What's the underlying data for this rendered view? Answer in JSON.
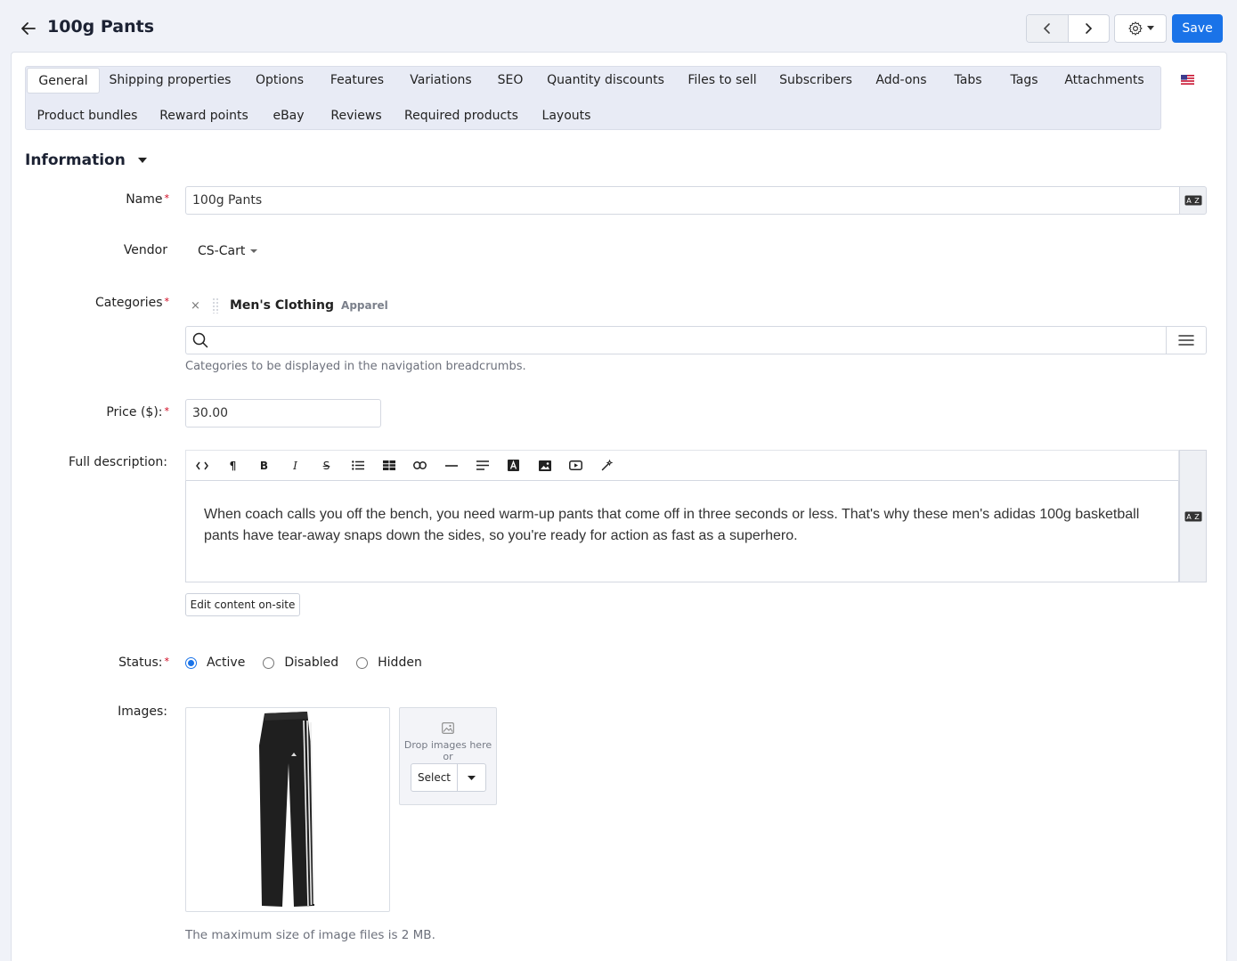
{
  "header": {
    "title": "100g Pants",
    "save_label": "Save"
  },
  "tabs": {
    "row1": [
      "General",
      "Shipping properties",
      "Options",
      "Features",
      "Variations",
      "SEO",
      "Quantity discounts",
      "Files to sell",
      "Subscribers",
      "Add-ons",
      "Tabs",
      "Tags",
      "Attachments"
    ],
    "row2": [
      "Product bundles",
      "Reward points",
      "eBay",
      "Reviews",
      "Required products",
      "Layouts"
    ],
    "active": "General"
  },
  "section": {
    "title": "Information"
  },
  "form": {
    "name_label": "Name",
    "name_value": "100g Pants",
    "vendor_label": "Vendor",
    "vendor_value": "CS-Cart",
    "categories_label": "Categories",
    "category_name": "Men's Clothing",
    "category_parent": "Apparel",
    "category_remove": "×",
    "categories_help": "Categories to be displayed in the navigation breadcrumbs.",
    "price_label": "Price ($):",
    "price_value": "30.00",
    "description_label": "Full description:",
    "description_text": "When coach calls you off the bench, you need warm-up pants that come off in three seconds or less. That's why these men's adidas 100g basketball pants have tear-away snaps down the sides, so you're ready for action as fast as a superhero.",
    "edit_onsite_label": "Edit content on-site",
    "status_label": "Status:",
    "status_options": [
      "Active",
      "Disabled",
      "Hidden"
    ],
    "status_selected": "Active",
    "images_label": "Images:",
    "drop_text_1": "Drop images here",
    "drop_text_2": "or",
    "select_label": "Select",
    "images_help": "The maximum size of image files is 2 MB."
  },
  "toolbar": {
    "paragraph_glyph": "¶",
    "bold_glyph": "B",
    "italic_glyph": "I",
    "strike_glyph": "S"
  },
  "colors": {
    "accent": "#1a73e8",
    "required": "#d0021b"
  }
}
